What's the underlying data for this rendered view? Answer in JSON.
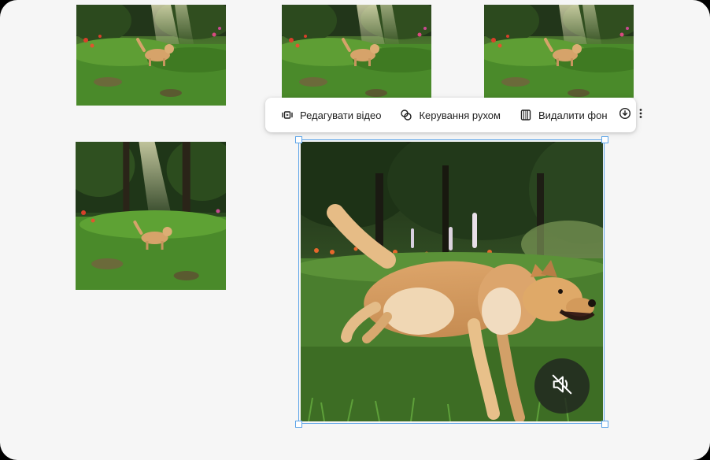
{
  "toolbar": {
    "edit_video_label": "Редагувати відео",
    "motion_control_label": "Керування рухом",
    "remove_background_label": "Видалити фон",
    "download_icon": "download-icon",
    "more_icon": "more-vert-icon"
  },
  "thumbnails": [
    {
      "name": "thumbnail-1",
      "subject": "dog running through forest meadow"
    },
    {
      "name": "thumbnail-2",
      "subject": "dog running through forest meadow"
    },
    {
      "name": "thumbnail-3",
      "subject": "dog running through forest meadow"
    },
    {
      "name": "thumbnail-4",
      "subject": "dog running through forest meadow"
    }
  ],
  "main": {
    "subject": "golden dog leaping across grass",
    "mute_icon": "volume-off-icon"
  },
  "colors": {
    "selection": "#5aa3e8",
    "canvas_bg": "#f6f6f6",
    "toolbar_bg": "#ffffff",
    "text": "#1f1f1f"
  }
}
